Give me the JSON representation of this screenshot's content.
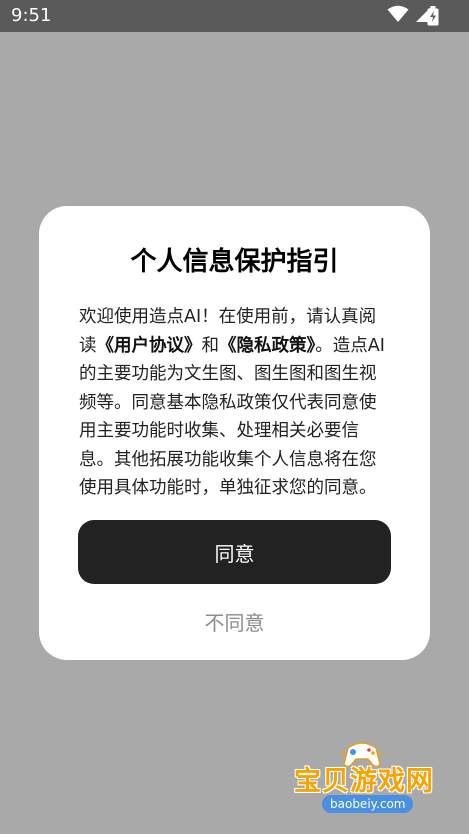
{
  "status_bar": {
    "time": "9:51",
    "icons": [
      "wifi-icon",
      "cellular-signal-icon",
      "battery-charging-icon"
    ]
  },
  "dialog": {
    "title": "个人信息保护指引",
    "body": {
      "intro": "欢迎使用造点AI！在使用前，请认真阅读",
      "user_agreement_link": "《用户协议》",
      "and": "和",
      "privacy_policy_link": "《隐私政策》",
      "details": "。造点AI的主要功能为文生图、图生图和图生视频等。同意基本隐私政策仅代表同意使用主要功能时收集、处理相关必要信息。其他拓展功能收集个人信息将在您使用具体功能时，单独征求您的同意。"
    },
    "agree_label": "同意",
    "disagree_label": "不同意"
  },
  "watermark": {
    "brand": "宝贝游戏网",
    "url": "baobeiy.com"
  },
  "colors": {
    "overlay": "#a9a9a9",
    "status_bar": "#5a5a5a",
    "dialog_background": "#ffffff",
    "primary_button": "#222222",
    "secondary_text": "#8c8c8c",
    "watermark_orange": "#f5a400",
    "watermark_blue": "#4a90e2"
  }
}
